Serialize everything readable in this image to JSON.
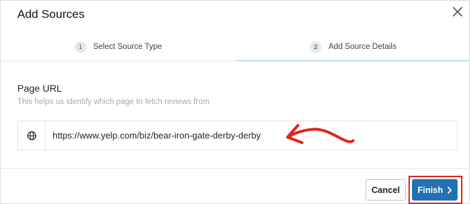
{
  "dialog": {
    "title": "Add Sources",
    "close_icon": "close-icon"
  },
  "steps": [
    {
      "number": "1",
      "label": "Select Source Type",
      "active": false
    },
    {
      "number": "2",
      "label": "Add Source Details",
      "active": true
    }
  ],
  "form": {
    "label": "Page URL",
    "help": "This helps us identify which page to fetch reviews from",
    "url_icon": "globe-icon",
    "url_value": "https://www.yelp.com/biz/bear-iron-gate-derby-derby"
  },
  "annotation": {
    "arrow_color": "#e1251b",
    "highlight_color": "#e1251b"
  },
  "footer": {
    "cancel_label": "Cancel",
    "finish_label": "Finish",
    "finish_icon": "chevron-right-icon"
  },
  "colors": {
    "primary": "#2271b1",
    "annotation_red": "#e1251b"
  }
}
